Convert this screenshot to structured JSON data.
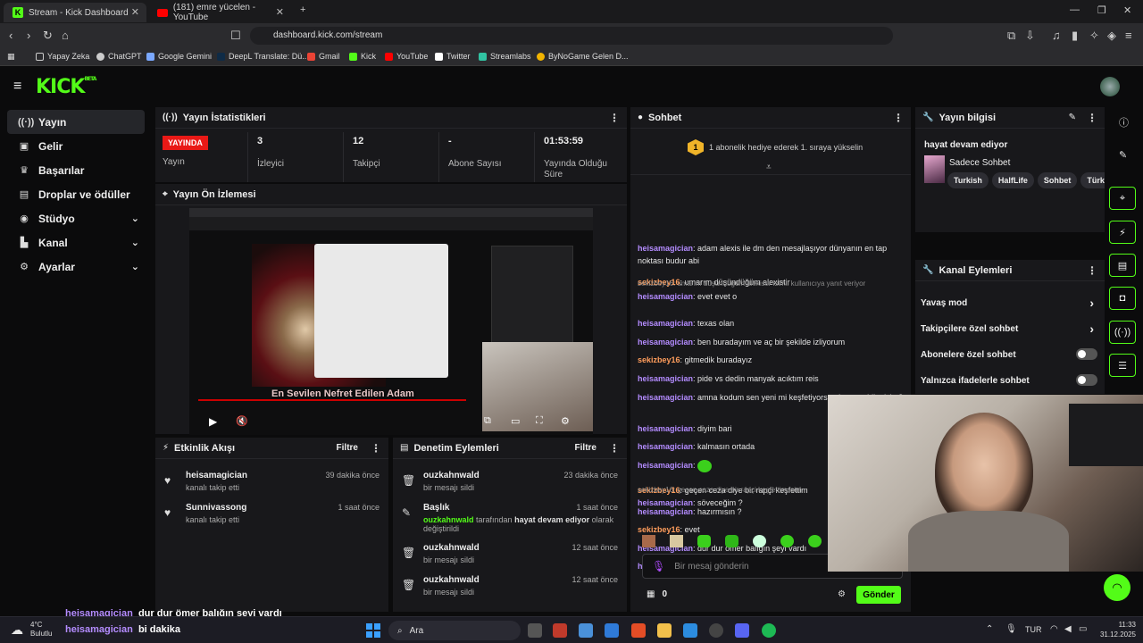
{
  "browser": {
    "tabs": [
      {
        "label": "Stream - Kick Dashboard"
      },
      {
        "label": "(181) emre yücelen - YouTube"
      }
    ],
    "url": "dashboard.kick.com/stream",
    "bookmarks": [
      "Yapay Zeka",
      "ChatGPT",
      "Google Gemini",
      "DeepL Translate: Dü...",
      "Gmail",
      "Kick",
      "YouTube",
      "Twitter",
      "Streamlabs",
      "ByNoGame Gelen D..."
    ]
  },
  "app": {
    "logo": "KICK",
    "beta": "BETA",
    "sidebar": [
      {
        "label": "Yayın",
        "icon": "broadcast-icon"
      },
      {
        "label": "Gelir",
        "icon": "wallet-icon"
      },
      {
        "label": "Başarılar",
        "icon": "trophy-icon"
      },
      {
        "label": "Droplar ve ödüller",
        "icon": "gift-icon"
      },
      {
        "label": "Stüdyo",
        "icon": "studio-icon"
      },
      {
        "label": "Kanal",
        "icon": "channel-icon"
      },
      {
        "label": "Ayarlar",
        "icon": "gear-icon"
      }
    ],
    "stats": {
      "title": "Yayın İstatistikleri",
      "live": "YAYINDA",
      "live_label": "Yayın",
      "viewers": "3",
      "viewers_label": "İzleyici",
      "followers": "12",
      "followers_label": "Takipçi",
      "subs": "-",
      "subs_label": "Abone Sayısı",
      "uptime": "01:53:59",
      "uptime_label": "Yayında Olduğu Süre"
    },
    "preview": {
      "title": "Yayın Ön İzlemesi",
      "caption": "En Sevilen Nefret Edilen Adam"
    },
    "activity": {
      "title": "Etkinlik Akışı",
      "filter": "Filtre",
      "items": [
        {
          "name": "heisamagician",
          "sub": "kanalı takip etti",
          "time": "39 dakika önce"
        },
        {
          "name": "Sunnivassong",
          "sub": "kanalı takip etti",
          "time": "1 saat önce"
        }
      ]
    },
    "moderation": {
      "title": "Denetim Eylemleri",
      "filter": "Filtre",
      "items": [
        {
          "name": "ouzkahnwald",
          "sub": "bir mesajı sildi",
          "time": "23 dakika önce"
        },
        {
          "name": "Başlık",
          "sub_user": "ouzkahnwald",
          "sub_mid": "tarafından",
          "sub_title": "hayat devam ediyor",
          "sub_end": "olarak",
          "sub_end2": "değiştirildi",
          "time": "1 saat önce"
        },
        {
          "name": "ouzkahnwald",
          "sub": "bir mesajı sildi",
          "time": "12 saat önce"
        },
        {
          "name": "ouzkahnwald",
          "sub": "bir mesajı sildi",
          "time": "12 saat önce"
        }
      ]
    },
    "chat": {
      "title": "Sohbet",
      "banner_badge": "1",
      "banner": "1 abonelik hediye ederek 1. sıraya yükselin",
      "messages": [
        {
          "user": "heisamagician",
          "text": "adam alexis ile dm den mesajlaşıyor dünyanın en tap noktası budur abi",
          "c": "u1"
        },
        {
          "user": "sekizbey16",
          "text": "umarım düşündüğüm alexistir",
          "c": "u2"
        },
        {
          "reply": "sekizbey16: umarım düşündüğüm alexistir isimli kullanıcıya yanıt veriyor",
          "user": "heisamagician",
          "text": "evet evet o",
          "c": "u1"
        },
        {
          "user": "heisamagician",
          "text": "texas olan",
          "c": "u1"
        },
        {
          "user": "heisamagician",
          "text": "ben buradayım ve aç bir şekilde izliyorum",
          "c": "u1"
        },
        {
          "user": "sekizbey16",
          "text": "gitmedik buradayız",
          "c": "u2"
        },
        {
          "user": "heisamagician",
          "text": "pide vs dedin manyak acıktım reis",
          "c": "u1"
        },
        {
          "user": "heisamagician",
          "text": "amna kodum sen yeni mi keşfetiyorsun bunu cahil misin ?",
          "c": "u1"
        },
        {
          "user": "heisamagician",
          "text": "diyim bari",
          "c": "u1"
        },
        {
          "user": "heisamagician",
          "text": "kalmasın ortada",
          "c": "u1"
        },
        {
          "user": "heisamagician",
          "text": "",
          "c": "u1"
        },
        {
          "user": "sekizbey16",
          "text": "geçen ceza diye bir rapçi keşfettim",
          "c": "u2"
        },
        {
          "reply": "sekizbey16: geçen ceza diye bir rapçi keşfettim isim",
          "user": "heisamagician",
          "text": "söveceğim ?",
          "c": "u1"
        },
        {
          "user": "heisamagician",
          "text": "hazırmısın ?",
          "c": "u1"
        },
        {
          "user": "sekizbey16",
          "text": "evet",
          "c": "u2"
        },
        {
          "user": "heisamagician",
          "text": "dur dur ömer balığın şeyi vardı",
          "c": "u1"
        },
        {
          "user": "heisamagician",
          "text": "bi dakika",
          "c": "u1"
        }
      ],
      "input_placeholder": "Bir mesaj gönderin",
      "points": "0",
      "send": "Gönder"
    },
    "stream_info": {
      "title": "Yayın bilgisi",
      "stream_title": "hayat devam ediyor",
      "category": "Sadece Sohbet",
      "tags": [
        "Turkish",
        "HalfLife",
        "Sohbet",
        "Türkç"
      ]
    },
    "channel_actions": {
      "title": "Kanal Eylemleri",
      "options": [
        "Yavaş mod",
        "Takipçilere özel sohbet",
        "Abonelere özel sohbet",
        "Yalnızca ifadelerle sohbet"
      ]
    }
  },
  "overlay": [
    {
      "user": "heisamagician",
      "text": "dur dur ömer balığın şeyi vardı"
    },
    {
      "user": "heisamagician",
      "text": "bi dakika"
    }
  ],
  "taskbar": {
    "weather_temp": "4°C",
    "weather_text": "Bulutlu",
    "search": "Ara",
    "lang": "TUR",
    "time": "11:33",
    "date": "31.12.2025"
  },
  "colors": {
    "accent": "#53fc18",
    "live": "#e91916"
  }
}
